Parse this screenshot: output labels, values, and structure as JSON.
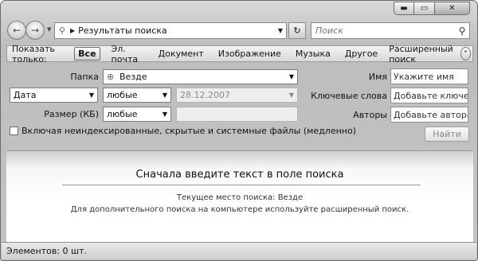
{
  "window": {
    "caption": {
      "minimize": "▬",
      "maximize": "▭",
      "close": "✕"
    }
  },
  "toolbar": {
    "back_icon": "back-arrow-icon",
    "forward_icon": "forward-arrow-icon",
    "address_path": "Результаты поиска",
    "search_placeholder": "Поиск"
  },
  "filterbar": {
    "label": "Показать только:",
    "tabs": [
      "Все",
      "Эл. почта",
      "Документ",
      "Изображение",
      "Музыка",
      "Другое"
    ],
    "active_tab": "Все",
    "advanced": "Расширенный поиск"
  },
  "advanced": {
    "location_label": "Папка",
    "location_value": "Везде",
    "date_field": "Дата",
    "date_qualifier": "любые",
    "date_value": "28.12.2007",
    "size_label": "Размер (КБ)",
    "size_qualifier": "любые",
    "name_label": "Имя",
    "name_placeholder": "Укажите имя",
    "keywords_label": "Ключевые слова",
    "keywords_placeholder": "Добавьте ключевое",
    "authors_label": "Авторы",
    "authors_placeholder": "Добавьте автора",
    "include_checkbox": "Включая неиндексированные, скрытые и системные файлы (медленно)",
    "find_button": "Найти"
  },
  "content": {
    "main_message": "Сначала введите текст в поле поиска",
    "current_location": "Текущее место поиска: Везде",
    "hint": "Для дополнительного поиска на компьютере используйте расширенный поиск."
  },
  "status": {
    "items": "Элементов: 0 шт."
  }
}
